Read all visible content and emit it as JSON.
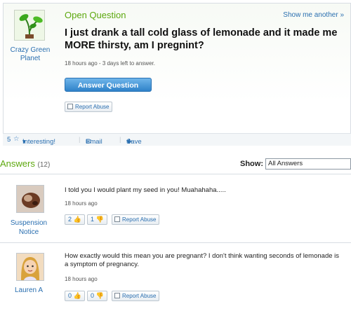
{
  "question": {
    "label": "Open Question",
    "show_another": "Show me another »",
    "asker_name": "Crazy Green Planet",
    "title": "I just drank a tall cold glass of lemonade and it made me MORE thirsty, am I pregnint?",
    "meta": "18 hours ago - 3 days left to answer.",
    "answer_button": "Answer Question",
    "report_abuse": "Report Abuse"
  },
  "toolbar": {
    "interesting_count": "5",
    "interesting": "Interesting!",
    "email": "Email",
    "save": "Save"
  },
  "answers_section": {
    "heading": "Answers",
    "count": "(12)",
    "show_label": "Show:",
    "show_value": "All Answers"
  },
  "answers": [
    {
      "name": "Suspension Notice",
      "text": "I told you I would plant my seed in you! Muahahaha.....",
      "meta": "18 hours ago",
      "thumbs_up": "2",
      "thumbs_down": "1",
      "report_abuse": "Report Abuse"
    },
    {
      "name": "Lauren A",
      "text": "How exactly would this mean you are pregnant? I don't think wanting seconds of lemonade is a symptom of pregnancy.",
      "meta": "18 hours ago",
      "thumbs_up": "0",
      "thumbs_down": "0",
      "report_abuse": "Report Abuse"
    }
  ],
  "colors": {
    "accent_green": "#5da80e",
    "link_blue": "#2a6fb0",
    "button_blue": "#2f82c9"
  }
}
